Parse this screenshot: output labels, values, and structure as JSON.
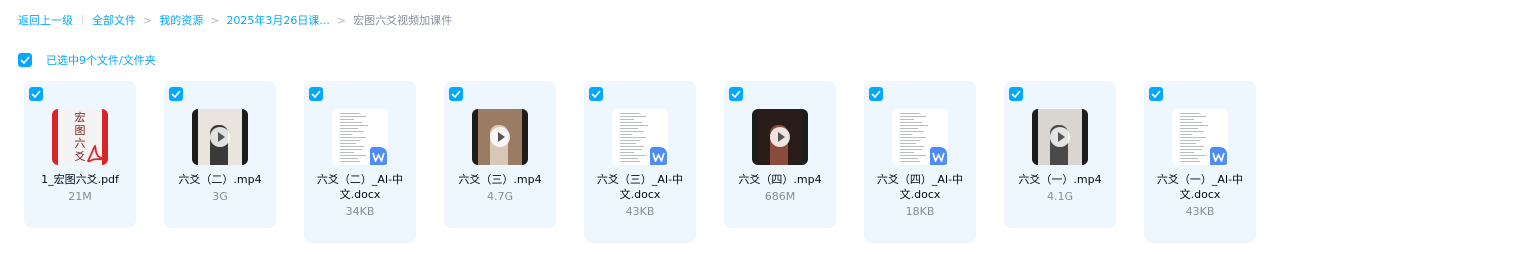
{
  "breadcrumb": {
    "back": "返回上一级",
    "items": [
      "全部文件",
      "我的资源",
      "2025年3月26日课..."
    ],
    "current": "宏图六爻视频加课件"
  },
  "selection": {
    "label": "已选中9个文件/文件夹",
    "checked": true
  },
  "colors": {
    "accent": "#06a7ff",
    "card_bg": "#eef7fe",
    "muted_text": "#878c9c",
    "pdf_red": "#d9242a",
    "word_blue": "#4e8df8"
  },
  "files": [
    {
      "type": "pdf",
      "icon": "pdf-icon",
      "name": "1_宏图六爻.pdf",
      "size": "21M",
      "checked": true,
      "cover_text": [
        "宏",
        "图",
        "六",
        "爻"
      ]
    },
    {
      "type": "video",
      "icon": "video-thumbnail-icon",
      "name": "六爻（二）.mp4",
      "size": "3G",
      "checked": true
    },
    {
      "type": "doc",
      "icon": "word-doc-icon",
      "name": "六爻（二）_AI-中文.docx",
      "size": "34KB",
      "checked": true
    },
    {
      "type": "video",
      "icon": "video-thumbnail-icon",
      "name": "六爻（三）.mp4",
      "size": "4.7G",
      "checked": true
    },
    {
      "type": "doc",
      "icon": "word-doc-icon",
      "name": "六爻（三）_AI-中文.docx",
      "size": "43KB",
      "checked": true
    },
    {
      "type": "video",
      "icon": "video-thumbnail-icon",
      "name": "六爻（四）.mp4",
      "size": "686M",
      "checked": true
    },
    {
      "type": "doc",
      "icon": "word-doc-icon",
      "name": "六爻（四）_AI-中文.docx",
      "size": "18KB",
      "checked": true
    },
    {
      "type": "video",
      "icon": "video-thumbnail-icon",
      "name": "六爻（一）.mp4",
      "size": "4.1G",
      "checked": true
    },
    {
      "type": "doc",
      "icon": "word-doc-icon",
      "name": "六爻（一）_AI-中文.docx",
      "size": "43KB",
      "checked": true
    }
  ]
}
